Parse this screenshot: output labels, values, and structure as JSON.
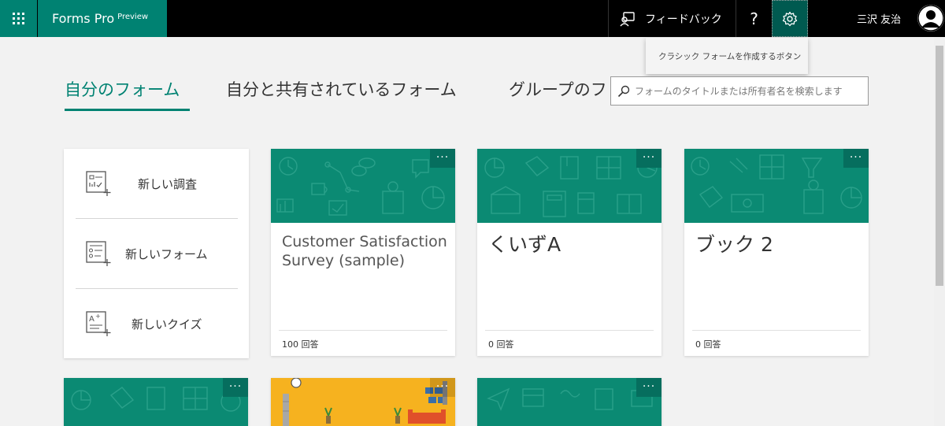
{
  "header": {
    "brand_name": "Forms Pro",
    "brand_tag": "Preview",
    "feedback_label": "フィードバック",
    "help_label": "?",
    "user_name": "三沢 友治"
  },
  "tooltip": {
    "text": "クラシック フォームを作成するボタン"
  },
  "tabs": [
    {
      "label": "自分のフォーム"
    },
    {
      "label": "自分と共有されているフォーム"
    },
    {
      "label": "グループのフ"
    }
  ],
  "search": {
    "placeholder": "フォームのタイトルまたは所有者名を検索します"
  },
  "new_items": [
    {
      "label": "新しい調査"
    },
    {
      "label": "新しいフォーム"
    },
    {
      "label": "新しいクイズ"
    }
  ],
  "cards": [
    {
      "title": "Customer Satisfaction Survey (sample)",
      "count": "100 回答"
    },
    {
      "title": "くいずA",
      "count": "0 回答"
    },
    {
      "title": "ブック 2",
      "count": "0 回答"
    }
  ],
  "menu_label": "...",
  "colors": {
    "accent": "#008272",
    "banner": "#0b8a73",
    "banner_orange": "#f6b21f"
  }
}
